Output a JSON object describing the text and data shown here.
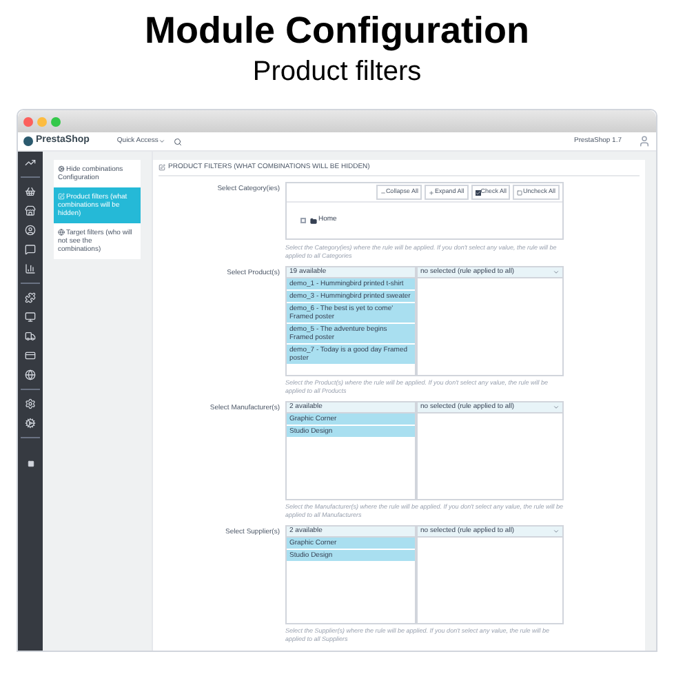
{
  "heading": {
    "title": "Module Configuration",
    "subtitle": "Product filters"
  },
  "header": {
    "logo": "PrestaShop",
    "quick_access": "Quick Access",
    "version": "PrestaShop 1.7"
  },
  "tabs": [
    {
      "label": "Hide combinations Configuration",
      "selected": false,
      "kind": "gears"
    },
    {
      "label": "Product filters (what combinations will be hidden)",
      "selected": true,
      "kind": "edit"
    },
    {
      "label": "Target filters (who will not see the combinations)",
      "selected": false,
      "kind": "globe"
    }
  ],
  "panel_title": "PRODUCT FILTERS (WHAT COMBINATIONS WILL BE HIDDEN)",
  "category": {
    "label": "Select Category(ies)",
    "buttons": [
      {
        "label": "Collapse All",
        "kind": "collapse"
      },
      {
        "label": "Expand All",
        "kind": "expand"
      },
      {
        "label": "Check All",
        "kind": "check"
      },
      {
        "label": "Uncheck All",
        "kind": "uncheck"
      }
    ],
    "tree": [
      {
        "label": "Home",
        "checked": false
      }
    ],
    "help": "Select the Category(ies) where the rule will be applied. If you don't select any value, the rule will be applied to all Categories"
  },
  "selectors": [
    {
      "label": "Select Product(s)",
      "available": "19 available",
      "items": [
        "demo_1 - Hummingbird printed t-shirt",
        "demo_3 - Hummingbird printed sweater",
        "demo_6 - The best is yet to come' Framed poster",
        "demo_5 - The adventure begins Framed poster",
        "demo_7 - Today is a good day Framed poster"
      ],
      "selected_header": "no selected (rule applied to all)",
      "help": "Select the Product(s) where the rule will be applied. If you don't select any value, the rule will be applied to all Products"
    },
    {
      "label": "Select Manufacturer(s)",
      "available": "2 available",
      "items": [
        "Graphic Corner",
        "Studio Design"
      ],
      "selected_header": "no selected (rule applied to all)",
      "help": "Select the Manufacturer(s) where the rule will be applied. If you don't select any value, the rule will be applied to all Manufacturers"
    },
    {
      "label": "Select Supplier(s)",
      "available": "2 available",
      "items": [
        "Graphic Corner",
        "Studio Design"
      ],
      "selected_header": "no selected (rule applied to all)",
      "help": "Select the Supplier(s) where the rule will be applied. If you don't select any value, the rule will be applied to all Suppliers"
    }
  ]
}
